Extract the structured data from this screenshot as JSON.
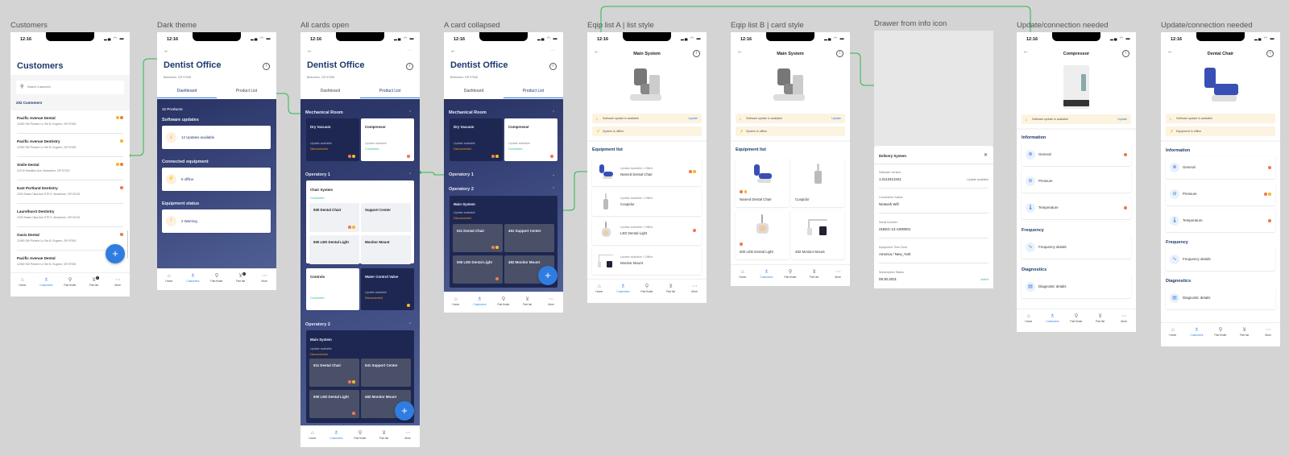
{
  "colors": {
    "accent": "#2f7de1",
    "navy": "#1b3a6b",
    "orange": "#f07a4a",
    "yellow": "#f5b82e",
    "connector": "#2db84d",
    "connected": "#2bb3a0",
    "disconnected": "#f0a020"
  },
  "status_time": "12:16",
  "nav": {
    "items": [
      {
        "label": "Home",
        "icon": "home-icon"
      },
      {
        "label": "Customers",
        "icon": "customers-icon"
      },
      {
        "label": "Part finder",
        "icon": "part-finder-icon"
      },
      {
        "label": "Part list",
        "icon": "cart-icon"
      },
      {
        "label": "More",
        "icon": "more-icon"
      }
    ],
    "badge": "1"
  },
  "customers": {
    "label": "Customers",
    "title": "Customers",
    "search_placeholder": "Search Customers",
    "count": "202 Customers",
    "items": [
      {
        "name": "Pacific Avenue Dental",
        "address": "12450 SW Pioneer Ln Ste B, Eugene, OR 97006",
        "dots": [
          "#f5b82e",
          "#f07a4a"
        ]
      },
      {
        "name": "Pacific Avenue Dentistry",
        "address": "12450 SW Pioneer Ln Ste B, Eugene, OR 97006",
        "dots": [
          "#f5b82e"
        ]
      },
      {
        "name": "Smile Dental",
        "address": "215 W Hamilton Ave, Beaverton, OR 97220",
        "dots": [
          "#f5b82e",
          "#f07a4a"
        ]
      },
      {
        "name": "East Portland Dentistry",
        "address": "2229 Santa Clara Ave STE E, Beaverton, OR 92132",
        "dots": [
          "#f07a4a"
        ]
      },
      {
        "name": "Laurelhurst Dentistry",
        "address": "2229 Santa Clara Ave STE E, Beaverton, OR 92132",
        "dots": []
      },
      {
        "name": "Oasis Dental",
        "address": "12450 SW Pioneer Ln Ste B, Eugene, OR 97006",
        "dots": [
          "#f07a4a"
        ]
      },
      {
        "name": "Pacific Avenue Dental",
        "address": "12450 SW Pioneer Ln Ste B, Eugene, OR 97006",
        "dots": []
      }
    ]
  },
  "office": {
    "title": "Dentist Office",
    "address": "Beaverton, OR 97008",
    "tabs": [
      "Dashboard",
      "Product List"
    ]
  },
  "dark_theme": {
    "label": "Dark theme",
    "products": "12 Products",
    "sections": [
      {
        "title": "Software updates",
        "text": "12 Updates available",
        "icon": "download-icon"
      },
      {
        "title": "Connected equipment",
        "text": "6 offline",
        "icon": "offline-icon"
      },
      {
        "title": "Equipment status",
        "text": "2 Warning",
        "icon": "warning-icon"
      }
    ]
  },
  "all_cards": {
    "label": "All cards open",
    "mechanical_room": {
      "title": "Mechanical Room",
      "cards": [
        {
          "title": "Dry Vacuum",
          "status": "Update available",
          "conn": "Disconnected",
          "dots": [
            "#f07a4a",
            "#f5b82e"
          ]
        },
        {
          "title": "Compressor",
          "status": "Update available",
          "conn": "Connected",
          "dots": [
            "#f07a4a"
          ]
        }
      ]
    },
    "operatory1": {
      "title": "Operatory 1",
      "system": "Chair System",
      "conn": "Connected",
      "subs": [
        {
          "title": "500 Dental Chair",
          "dots": [
            "#f07a4a",
            "#f5b82e"
          ]
        },
        {
          "title": "Support  Center",
          "dots": []
        },
        {
          "title": "500 LED Dental Light",
          "dots": []
        },
        {
          "title": "Monitor Mount",
          "dots": []
        }
      ],
      "row": [
        {
          "title": "Controls",
          "conn": "Connected",
          "dots": []
        },
        {
          "title": "Water Control Valve",
          "status": "Update available",
          "conn": "Disconnected",
          "dots": [
            "#f5b82e"
          ]
        }
      ]
    },
    "operatory2": {
      "title": "Operatory 2",
      "system": "Main System",
      "status": "Update available",
      "conn": "Disconnected",
      "subs": [
        {
          "title": "511 Dental Chair",
          "dots": [
            "#f07a4a",
            "#f5b82e"
          ]
        },
        {
          "title": "541 Support Center",
          "dots": []
        },
        {
          "title": "500 LED Dental Light",
          "dots": [
            "#f07a4a"
          ]
        },
        {
          "title": "482 Monitor Mount",
          "dots": []
        }
      ]
    }
  },
  "collapsed": {
    "label": "A card collapsed",
    "operatory2_subs": [
      {
        "title": "511 Dental Chair",
        "dots": [
          "#f07a4a",
          "#f5b82e"
        ]
      },
      {
        "title": "461 Support Center",
        "dots": []
      },
      {
        "title": "500 LED Dental Light",
        "dots": [
          "#f07a4a"
        ]
      },
      {
        "title": "482 Monitor Mount",
        "dots": []
      }
    ]
  },
  "main_system": {
    "title": "Main System",
    "banners": [
      {
        "text": "Software update is available",
        "link": "Update",
        "icon": "download-icon"
      },
      {
        "text": "System is offline",
        "icon": "offline-icon"
      }
    ],
    "equipment_title": "Equipment list"
  },
  "eqip_a": {
    "label": "Eqip list A | list style",
    "items": [
      {
        "meta": "Update available • Offline",
        "name": "Named Dental Chair",
        "dots": [
          "#f07a4a",
          "#f5b82e"
        ],
        "img": "dental-chair"
      },
      {
        "meta": "Update available • Offline",
        "name": "Cuspidor",
        "dots": [],
        "img": "cuspidor"
      },
      {
        "meta": "Update available • Offline",
        "name": "LED Dental Light",
        "dots": [
          "#f07a4a"
        ],
        "img": "light"
      },
      {
        "meta": "Update available • Offline",
        "name": "Monitor Mount",
        "dots": [],
        "img": "monitor"
      }
    ]
  },
  "eqip_b": {
    "label": "Eqip list B | card style",
    "items": [
      {
        "name": "Named Dental Chair",
        "dots": [
          "#f07a4a",
          "#f5b82e"
        ],
        "img": "dental-chair"
      },
      {
        "name": "Cuspidor",
        "dots": [],
        "img": "cuspidor"
      },
      {
        "name": "500 LED Dental Light",
        "dots": [
          "#f07a4a"
        ],
        "img": "light"
      },
      {
        "name": "482 Monitor Mount",
        "dots": [],
        "img": "monitor"
      }
    ]
  },
  "drawer": {
    "label": "Drawer from info icon",
    "title": "Delivery System",
    "rows": [
      {
        "label": "Software Version",
        "value": "1.0113412341",
        "extra": "Update available"
      },
      {
        "label": "Connection Status",
        "value": "Network Wifi"
      },
      {
        "label": "Serial Number",
        "value": "21BSC-12-A000001"
      },
      {
        "label": "Equipment Time Zone",
        "value": "America / New_York"
      },
      {
        "label": "Subscription Status",
        "value": "09.30.2021",
        "extra": "Active"
      }
    ]
  },
  "compressor": {
    "label": "Update/connection needed",
    "title": "Compressor",
    "banners": [
      {
        "text": "Software update is available",
        "link": "Update",
        "icon": "download-icon"
      }
    ],
    "sections": [
      {
        "title": "Information",
        "rows": [
          {
            "text": "General",
            "icon": "general-icon",
            "dots": [
              "#f07a4a"
            ]
          },
          {
            "text": "Pressure",
            "icon": "pressure-icon",
            "dots": []
          },
          {
            "text": "Temperature",
            "icon": "temperature-icon",
            "dots": [
              "#f07a4a"
            ]
          }
        ]
      },
      {
        "title": "Frequency",
        "rows": [
          {
            "text": "Frequency details",
            "icon": "frequency-icon",
            "dots": []
          }
        ]
      },
      {
        "title": "Diagnostics",
        "rows": [
          {
            "text": "Diagnostic details",
            "icon": "diagnostic-icon",
            "dots": []
          }
        ]
      }
    ]
  },
  "dental_chair": {
    "label": "Update/connection needed",
    "title": "Dental Chair",
    "banners": [
      {
        "text": "Software update is available",
        "icon": "download-icon"
      },
      {
        "text": "Equipment is offline",
        "icon": "offline-icon"
      }
    ],
    "sections": [
      {
        "title": "Information",
        "rows": [
          {
            "text": "General",
            "icon": "general-icon",
            "dots": [
              "#f07a4a"
            ]
          },
          {
            "text": "Pressure",
            "icon": "pressure-icon",
            "dots": [
              "#f07a4a",
              "#f5b82e"
            ]
          },
          {
            "text": "Temperature",
            "icon": "temperature-icon",
            "dots": [
              "#f07a4a"
            ]
          }
        ]
      },
      {
        "title": "Frequency",
        "rows": [
          {
            "text": "Frequency details",
            "icon": "frequency-icon",
            "dots": []
          }
        ]
      },
      {
        "title": "Diagnostics",
        "rows": [
          {
            "text": "Diagnostic details",
            "icon": "diagnostic-icon",
            "dots": []
          }
        ]
      }
    ]
  }
}
